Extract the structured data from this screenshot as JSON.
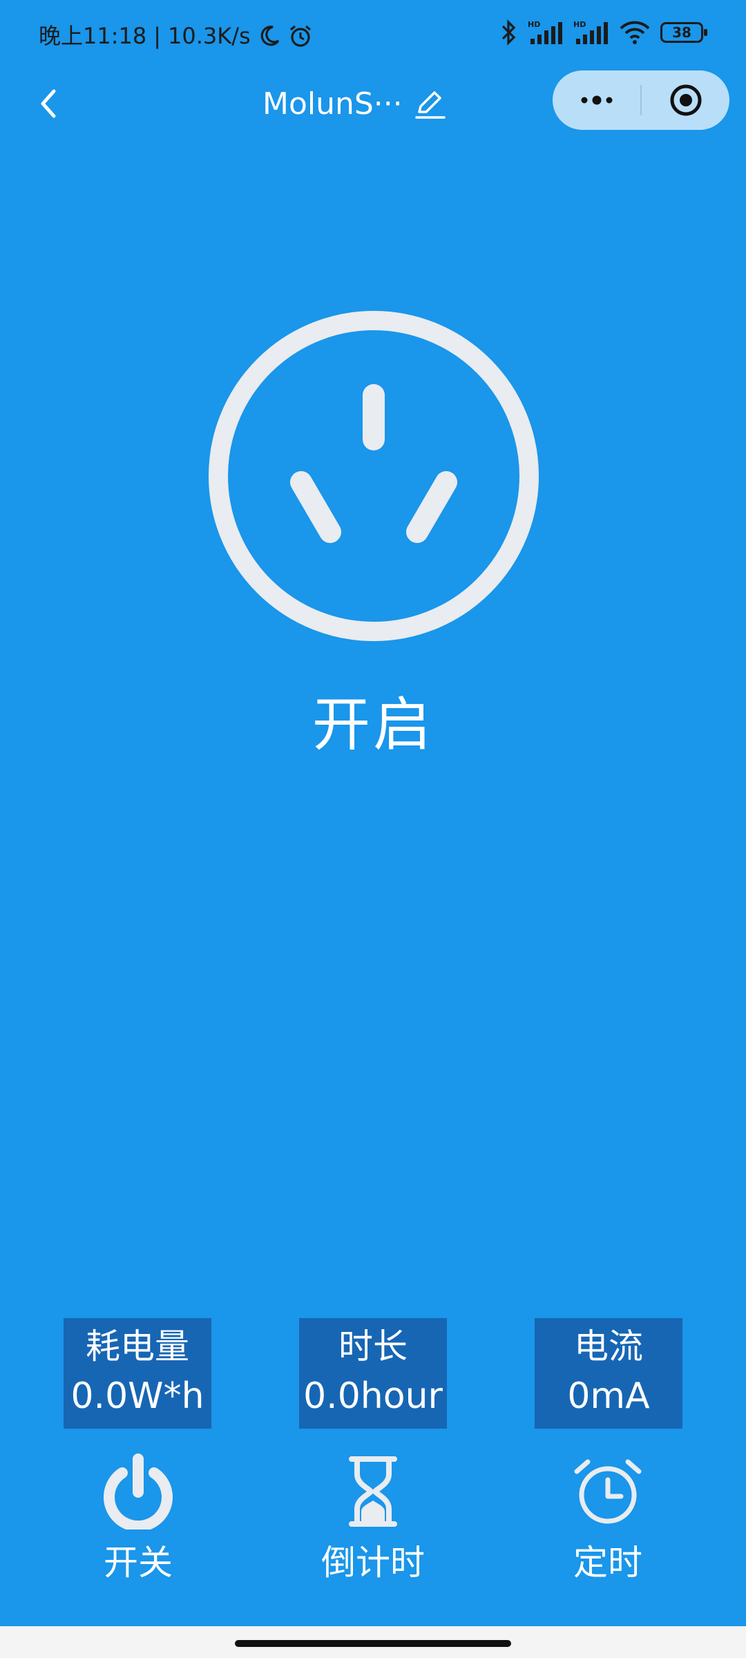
{
  "status_bar": {
    "time": "晚上11:18",
    "network_speed": "10.3K/s",
    "battery": "38",
    "icons": [
      "moon-icon",
      "alarm-icon",
      "bluetooth-icon",
      "signal-hd-icon",
      "signal-hd-icon",
      "wifi-icon",
      "battery-icon"
    ]
  },
  "nav": {
    "title": "MolunS···",
    "back_icon": "chevron-left-icon",
    "edit_icon": "pencil-icon",
    "more_icon": "more-dots-icon",
    "close_icon": "target-icon"
  },
  "device": {
    "state_label": "开启",
    "icon": "socket-icon"
  },
  "stats": {
    "energy": {
      "label": "耗电量",
      "value": "0.0W*h"
    },
    "duration": {
      "label": "时长",
      "value": "0.0hour"
    },
    "current": {
      "label": "电流",
      "value": "0mA"
    }
  },
  "actions": {
    "power": {
      "label": "开关",
      "icon": "power-icon"
    },
    "countdown": {
      "label": "倒计时",
      "icon": "hourglass-icon"
    },
    "timer": {
      "label": "定时",
      "icon": "alarm-clock-icon"
    }
  },
  "colors": {
    "background": "#1a96ea",
    "stat_box": "#1766b4",
    "capsule": "#b9def8",
    "icon_light": "#e9ecf0"
  }
}
